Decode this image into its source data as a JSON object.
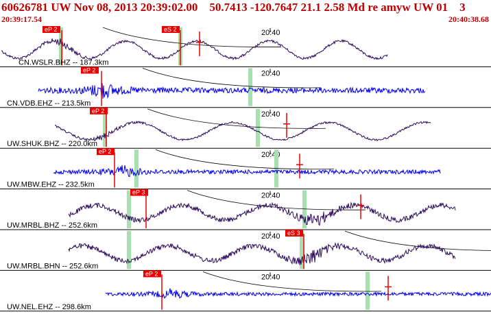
{
  "header": {
    "title": "60626781 UW Nov 08, 2013 20:39:02.00    50.7413 -120.7647 21.1 2.58 Md re amyw UW 01    3",
    "start_time": "20:39:17.54",
    "end_time": "20:40:38.68"
  },
  "time_tick_label": "20:40",
  "colors": {
    "header_text": "#c00000",
    "blue_trace": "#0000ee",
    "purple_trace": "#2b0a5a",
    "pick": "#ee0000",
    "window": "#a8e0b0"
  },
  "channels": [
    {
      "label": "CN.WSLR.BHZ -- 187.3km",
      "picks": [
        "eP 2",
        "eS 2"
      ],
      "trace_color": "purple"
    },
    {
      "label": "CN.VDB.EHZ -- 213.5km",
      "picks": [
        "eP 2"
      ],
      "trace_color": "blue"
    },
    {
      "label": "UW.SHUK.BHZ -- 220.0km",
      "picks": [
        "eP 2"
      ],
      "trace_color": "purple"
    },
    {
      "label": "UW.MBW.EHZ -- 232.5km",
      "picks": [
        "eP 2"
      ],
      "trace_color": "blue"
    },
    {
      "label": "UW.MRBL.BHZ -- 252.6km",
      "picks": [
        "eP 3"
      ],
      "trace_color": "purple"
    },
    {
      "label": "UW.MRBL.BHN -- 252.6km",
      "picks": [
        "eS 3"
      ],
      "trace_color": "purple"
    },
    {
      "label": "UW.NEL.EHZ -- 298.6km",
      "picks": [
        "eP 2"
      ],
      "trace_color": "blue"
    }
  ]
}
